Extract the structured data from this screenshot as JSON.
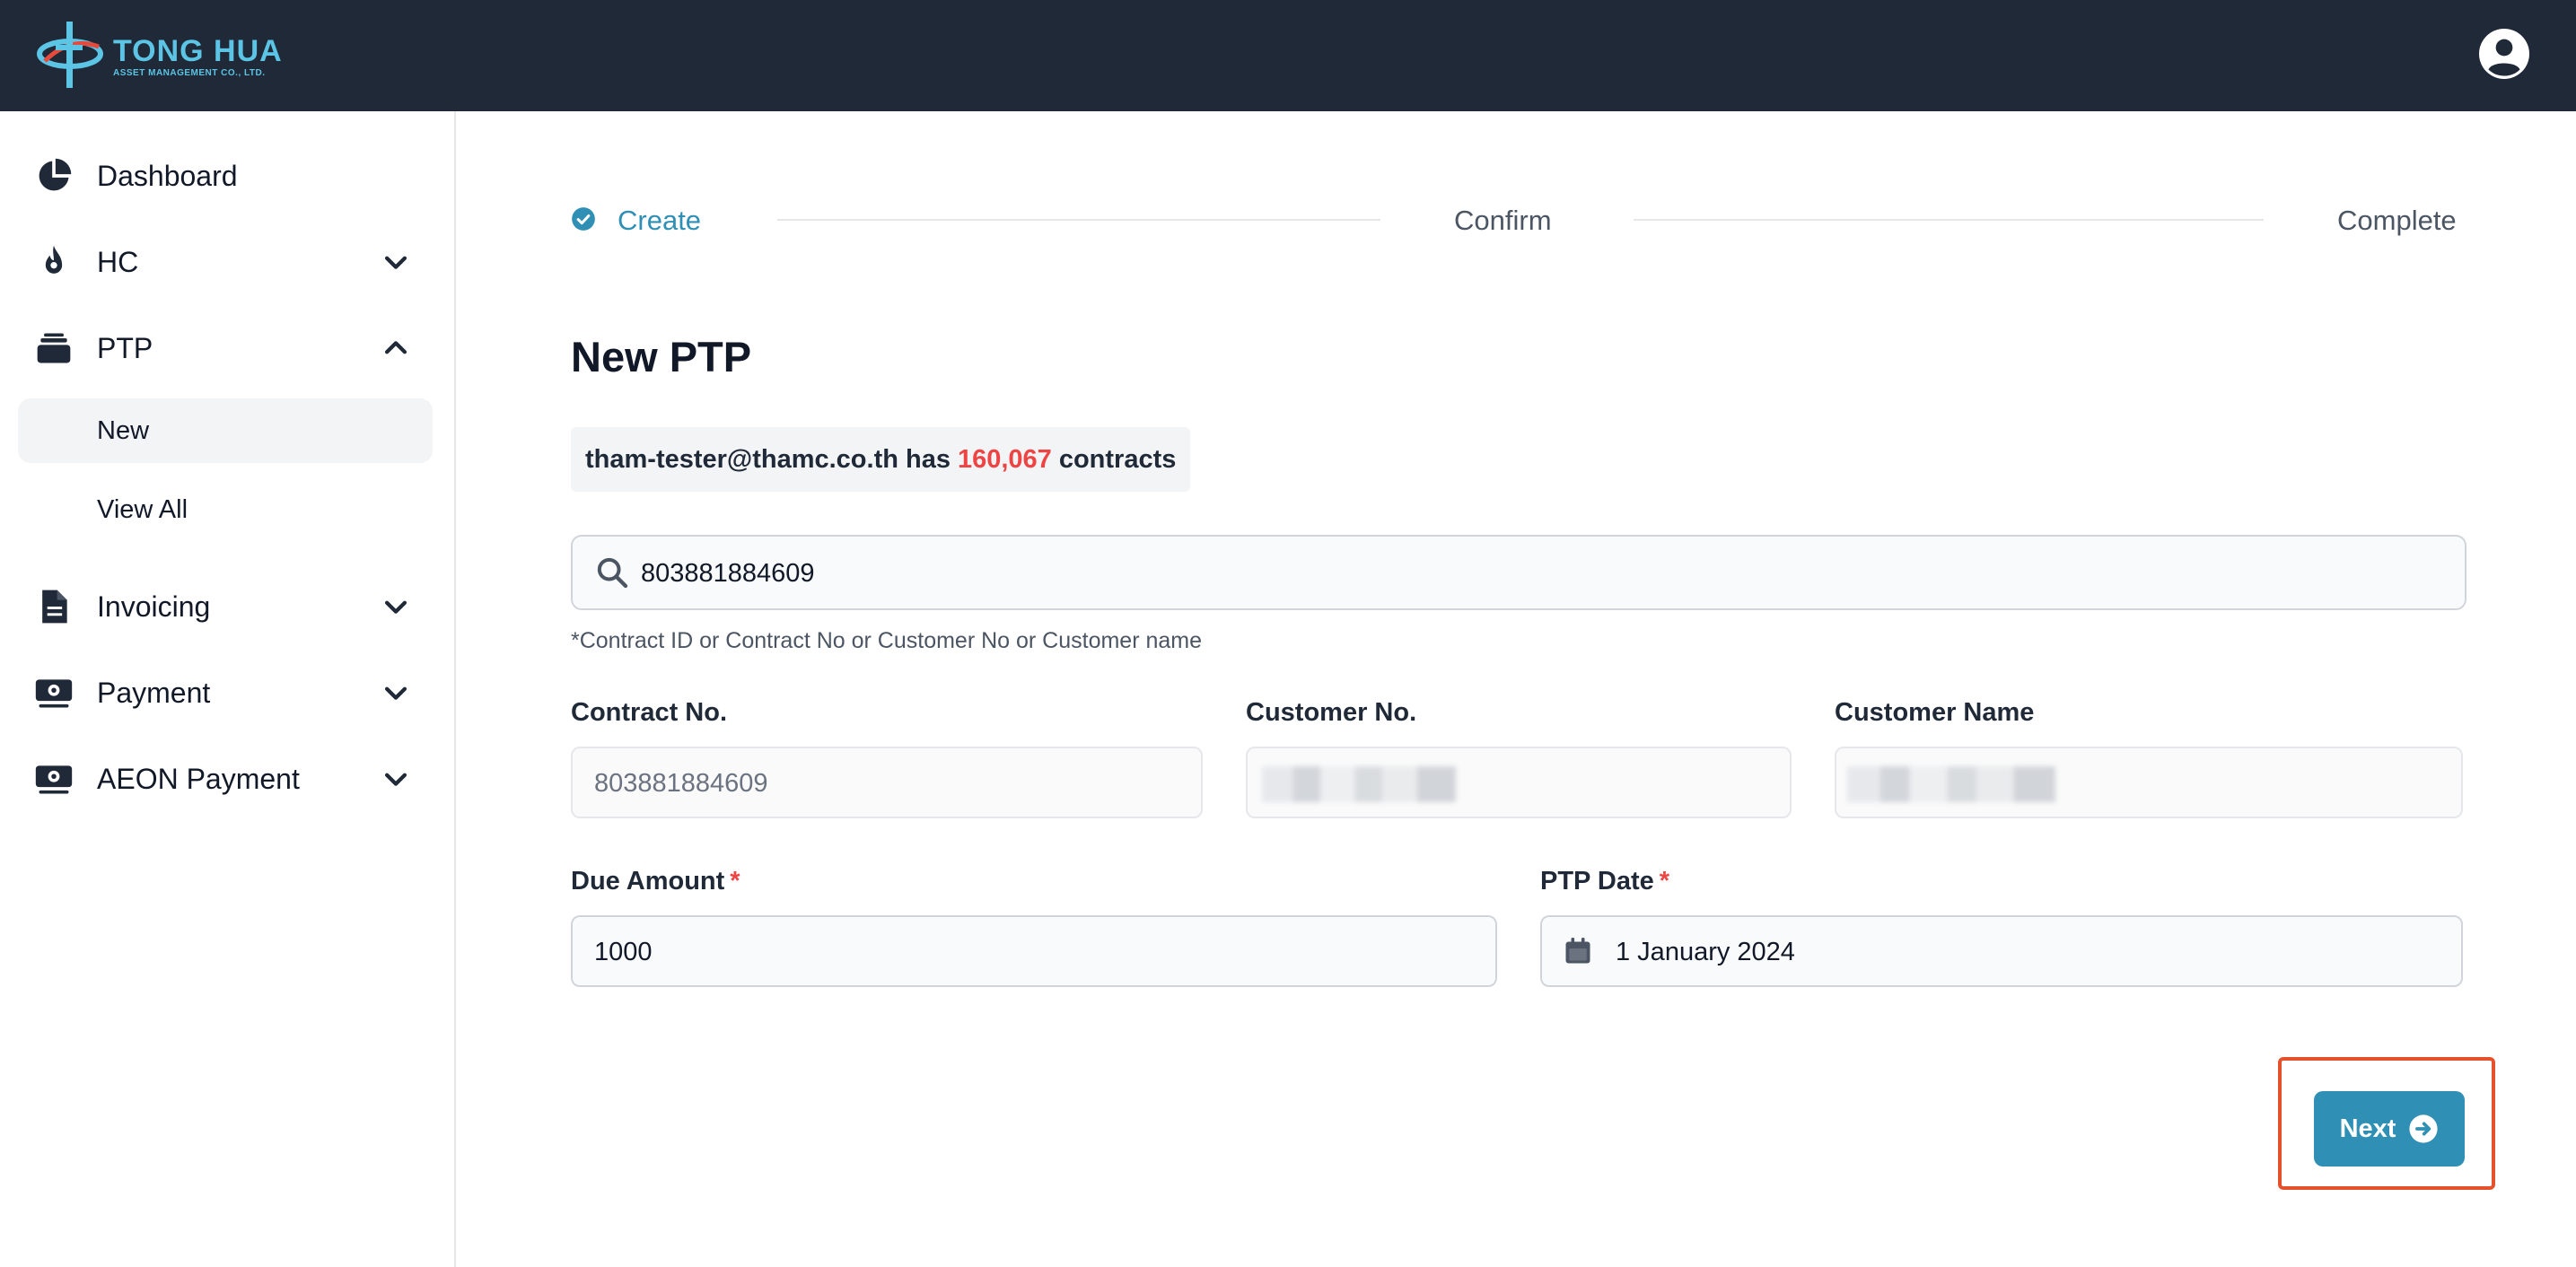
{
  "brand": {
    "name": "TONG HUA",
    "subtitle": "ASSET MANAGEMENT CO., LTD.",
    "accent": "#5cc4e4",
    "header_bg": "#1f2937"
  },
  "sidebar": {
    "items": [
      {
        "label": "Dashboard",
        "icon": "pie-chart-icon"
      },
      {
        "label": "HC",
        "icon": "fire-icon",
        "chevron": "chevron-down-icon"
      },
      {
        "label": "PTP",
        "icon": "stack-icon",
        "chevron": "chevron-up-icon",
        "expanded": true
      },
      {
        "label": "Invoicing",
        "icon": "document-icon",
        "chevron": "chevron-down-icon"
      },
      {
        "label": "Payment",
        "icon": "cash-icon",
        "chevron": "chevron-down-icon"
      },
      {
        "label": "AEON Payment",
        "icon": "cash-icon",
        "chevron": "chevron-down-icon"
      }
    ],
    "ptp_children": [
      {
        "label": "New",
        "active": true
      },
      {
        "label": "View All"
      }
    ]
  },
  "steps": [
    {
      "label": "Create",
      "state": "current"
    },
    {
      "label": "Confirm",
      "state": "upcoming"
    },
    {
      "label": "Complete",
      "state": "upcoming"
    }
  ],
  "page": {
    "title": "New PTP",
    "count_prefix": "tham-tester@thamc.co.th has",
    "count_value": "160,067",
    "count_suffix": "contracts"
  },
  "search": {
    "value": "803881884609",
    "hint": "*Contract ID or Contract No or Customer No or Customer name"
  },
  "fields": {
    "contract_no": {
      "label": "Contract No.",
      "value": "803881884609"
    },
    "customer_no": {
      "label": "Customer No."
    },
    "customer_name": {
      "label": "Customer Name"
    },
    "due_amount": {
      "label": "Due Amount",
      "value": "1000",
      "required_mark": "*"
    },
    "ptp_date": {
      "label": "PTP Date",
      "value": "1 January 2024",
      "required_mark": "*"
    }
  },
  "actions": {
    "next_label": "Next",
    "button_color": "#2f8fb5",
    "highlight_color": "#e4512c"
  }
}
